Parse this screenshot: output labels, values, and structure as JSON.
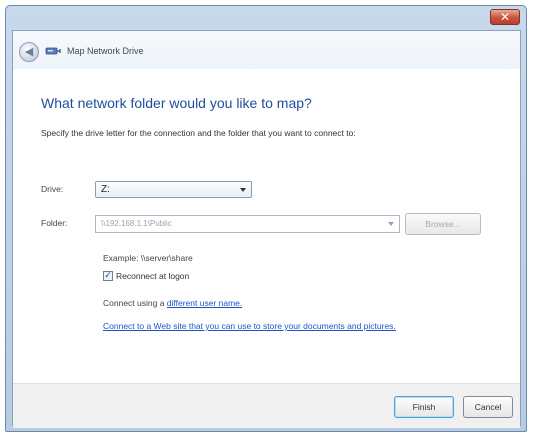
{
  "window": {
    "close_glyph": "✕",
    "close_icon": "close-icon"
  },
  "header": {
    "back_glyph": "◀",
    "back_icon": "back-arrow-icon",
    "wizard_icon": "network-drive-icon",
    "title": "Map Network Drive"
  },
  "main": {
    "heading": "What network folder would you like to map?",
    "instruction": "Specify the drive letter for the connection and the folder that you want to connect to:",
    "drive_label": "Drive:",
    "drive_value": "Z:",
    "folder_label": "Folder:",
    "folder_value": "\\\\192.168.1.1\\Public",
    "browse_label": "Browse...",
    "example": "Example: \\\\server\\share",
    "reconnect_checked": true,
    "reconnect_check_glyph": "✓",
    "reconnect_label": "Reconnect at logon",
    "connect_using_prefix": "Connect using a ",
    "different_user_link": "different user name.",
    "web_site_link": "Connect to a Web site that you can use to store your documents and pictures."
  },
  "footer": {
    "finish_label": "Finish",
    "cancel_label": "Cancel"
  },
  "colors": {
    "heading": "#1f4e9c",
    "link": "#1d55c9",
    "titlebar": "#c8d9ec",
    "close_button": "#c8533c"
  }
}
